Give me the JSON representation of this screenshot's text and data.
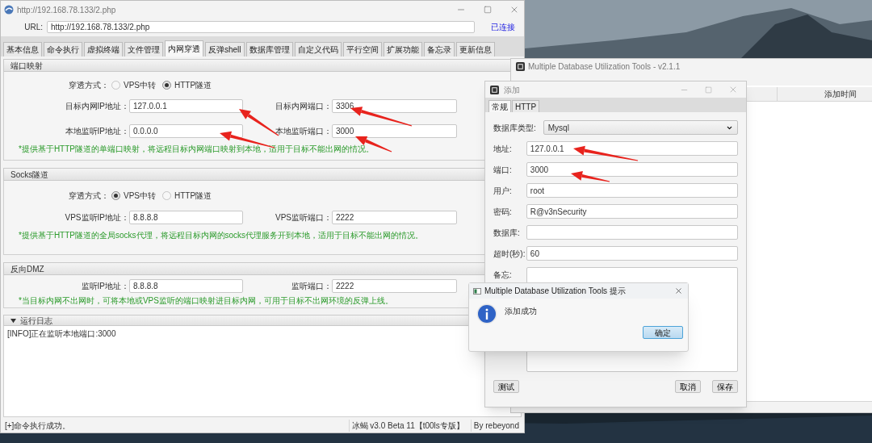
{
  "main_window": {
    "title": "http://192.168.78.133/2.php",
    "url_label": "URL:",
    "url": "http://192.168.78.133/2.php",
    "connection_status": "已连接",
    "tabs": [
      {
        "label": "基本信息",
        "selected": false
      },
      {
        "label": "命令执行",
        "selected": false
      },
      {
        "label": "虚拟终端",
        "selected": false
      },
      {
        "label": "文件管理",
        "selected": false
      },
      {
        "label": "内网穿透",
        "selected": true
      },
      {
        "label": "反弹shell",
        "selected": false
      },
      {
        "label": "数据库管理",
        "selected": false
      },
      {
        "label": "自定义代码",
        "selected": false
      },
      {
        "label": "平行空间",
        "selected": false
      },
      {
        "label": "扩展功能",
        "selected": false
      },
      {
        "label": "备忘录",
        "selected": false
      },
      {
        "label": "更新信息",
        "selected": false
      }
    ],
    "port_mapping": {
      "title": "端口映射",
      "mode_label": "穿透方式：",
      "modes": [
        {
          "label": "VPS中转",
          "selected": false
        },
        {
          "label": "HTTP隧道",
          "selected": true
        }
      ],
      "fields": [
        {
          "label": "目标内网IP地址：",
          "value": "127.0.0.1"
        },
        {
          "label": "目标内网端口：",
          "value": "3306"
        },
        {
          "label": "本地监听IP地址：",
          "value": "0.0.0.0"
        },
        {
          "label": "本地监听端口：",
          "value": "3000"
        }
      ],
      "note": "*提供基于HTTP隧道的单端口映射，将远程目标内网端口映射到本地，适用于目标不能出网的情况。"
    },
    "socks_tunnel": {
      "title": "Socks隧道",
      "mode_label": "穿透方式：",
      "modes": [
        {
          "label": "VPS中转",
          "selected": true
        },
        {
          "label": "HTTP隧道",
          "selected": false
        }
      ],
      "fields": [
        {
          "label": "VPS监听IP地址：",
          "value": "8.8.8.8"
        },
        {
          "label": "VPS监听端口：",
          "value": "2222"
        }
      ],
      "note": "*提供基于HTTP隧道的全局socks代理，将远程目标内网的socks代理服务开到本地，适用于目标不能出网的情况。"
    },
    "reverse_dmz": {
      "title": "反向DMZ",
      "fields": [
        {
          "label": "监听IP地址：",
          "value": "8.8.8.8"
        },
        {
          "label": "监听端口：",
          "value": "2222"
        }
      ],
      "note": "*当目标内网不出网时，可将本地或VPS监听的端口映射进目标内网，可用于目标不出网环境的反弹上线。"
    },
    "log": {
      "title": "运行日志",
      "expanded": true,
      "lines": [
        "[INFO]正在监听本地端口:3000"
      ]
    },
    "status_bar": {
      "message": "[+]命令执行成功。",
      "version": "冰蝎 v3.0 Beta 11【t00ls专版】",
      "author": "By rebeyond"
    }
  },
  "db_tool_window": {
    "title": "Multiple Database Utilization Tools - v2.1.1",
    "columns": [
      "添加时间"
    ]
  },
  "add_dialog": {
    "title": "添加",
    "tabs": [
      {
        "label": "常规",
        "selected": true
      },
      {
        "label": "HTTP",
        "selected": false
      }
    ],
    "db_type_label": "数据库类型:",
    "db_type": "Mysql",
    "fields": [
      {
        "label": "地址:",
        "value": "127.0.0.1"
      },
      {
        "label": "端口:",
        "value": "3000"
      },
      {
        "label": "用户:",
        "value": "root"
      },
      {
        "label": "密码:",
        "value": "R@v3nSecurity"
      },
      {
        "label": "数据库:"
      },
      {
        "label": "超时(秒):",
        "value": "60"
      }
    ],
    "notes_label": "备忘:",
    "buttons": [
      "测试",
      "取消",
      "保存"
    ]
  },
  "alert": {
    "title": "Multiple Database Utilization Tools 提示",
    "message": "添加成功",
    "button": "确定"
  }
}
